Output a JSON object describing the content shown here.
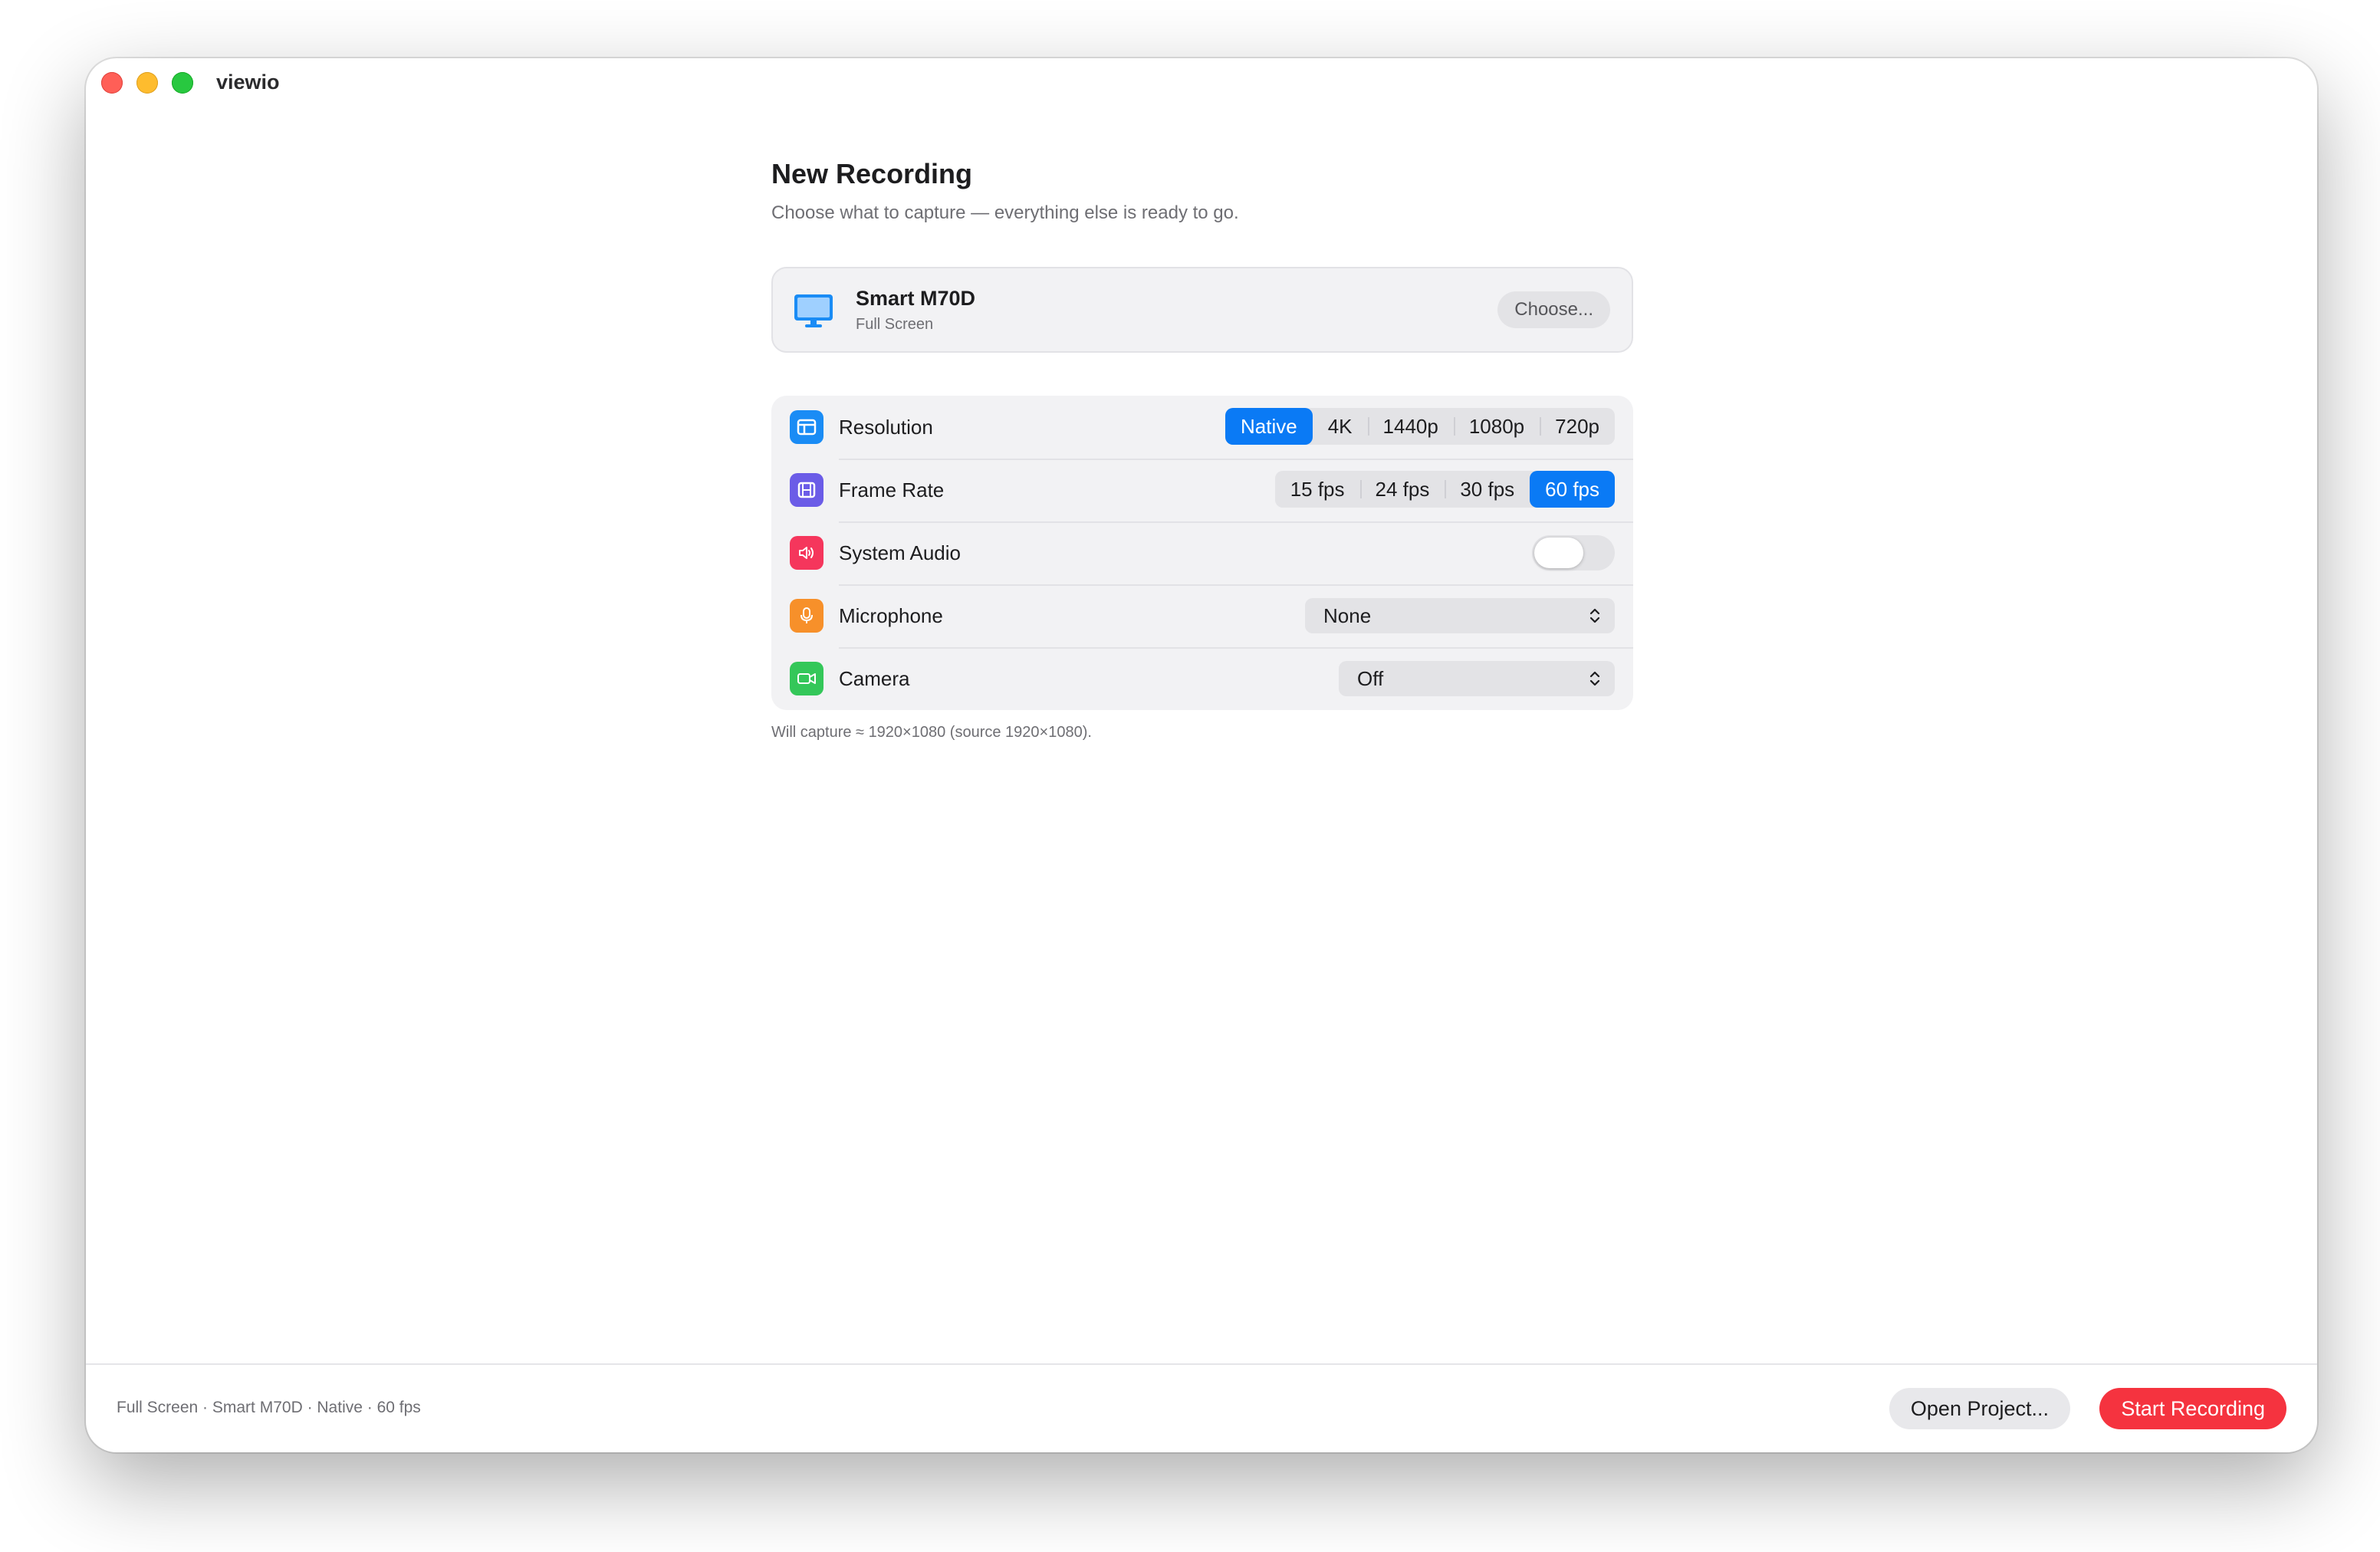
{
  "window": {
    "title": "viewio"
  },
  "heading": "New Recording",
  "subheading": "Choose what to capture — everything else is ready to go.",
  "source": {
    "name": "Smart M70D",
    "mode": "Full Screen",
    "choose_label": "Choose...",
    "icon": "display-icon"
  },
  "settings": {
    "resolution": {
      "label": "Resolution",
      "icon": "resolution-icon",
      "icon_color": "#1a8cf5",
      "options": [
        "Native",
        "4K",
        "1440p",
        "1080p",
        "720p"
      ],
      "selected": "Native"
    },
    "frame_rate": {
      "label": "Frame Rate",
      "icon": "film-icon",
      "icon_color": "#6b5ce7",
      "options": [
        "15 fps",
        "24 fps",
        "30 fps",
        "60 fps"
      ],
      "selected": "60 fps"
    },
    "system_audio": {
      "label": "System Audio",
      "icon": "speaker-icon",
      "icon_color": "#f5365c",
      "enabled": false
    },
    "microphone": {
      "label": "Microphone",
      "icon": "microphone-icon",
      "icon_color": "#f7902a",
      "value": "None"
    },
    "camera": {
      "label": "Camera",
      "icon": "video-camera-icon",
      "icon_color": "#34c759",
      "value": "Off"
    }
  },
  "capture_note": "Will capture ≈ 1920×1080 (source 1920×1080).",
  "footer": {
    "summary": "Full Screen · Smart M70D · Native · 60 fps",
    "open_label": "Open Project...",
    "start_label": "Start Recording"
  },
  "colors": {
    "accent": "#0a7af5",
    "record": "#f5333f"
  }
}
